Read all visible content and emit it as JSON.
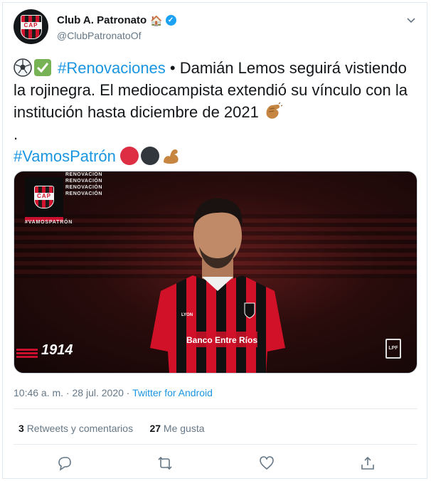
{
  "author": {
    "name": "Club A. Patronato",
    "handle": "@ClubPatronatoOf",
    "badge_icon": "house-icon",
    "verified_icon": "verified-icon",
    "avatar_text": "CAP"
  },
  "tweet": {
    "hashtag1": "#Renovaciones",
    "sep": " • ",
    "text": "Damián Lemos seguirá vistiendo la rojinegra. El mediocampista extendió su vínculo con la institución hasta diciembre de 2021",
    "dot_line": ".",
    "hashtag2": "#VamosPatrón",
    "emojis": [
      "soccer-ball-icon",
      "check-mark-icon",
      "clapping-hands-icon",
      "red-circle-icon",
      "black-circle-icon",
      "flexed-biceps-icon"
    ],
    "colors": {
      "red": "#dd2e44",
      "black": "#31373d",
      "skin": "#c68642",
      "check": "#77b255"
    }
  },
  "media": {
    "renovacion": [
      "RENOVACIÓN",
      "RENOVACIÓN",
      "RENOVACIÓN",
      "RENOVACIÓN"
    ],
    "vamos": "#VAMOSPATRÓN",
    "year": "1914",
    "sponsor": "Banco Entre Ríos",
    "kit_brand": "LYON",
    "lpf": "LPF"
  },
  "meta": {
    "time": "10:46 a. m.",
    "sep": " · ",
    "date": "28 jul. 2020",
    "sep2": " · ",
    "source": "Twitter for Android"
  },
  "stats": {
    "retweets": "3",
    "retweets_label": "Retweets y comentarios",
    "likes": "27",
    "likes_label": "Me gusta"
  },
  "actions": [
    "reply-icon",
    "retweet-icon",
    "like-icon",
    "share-icon"
  ]
}
